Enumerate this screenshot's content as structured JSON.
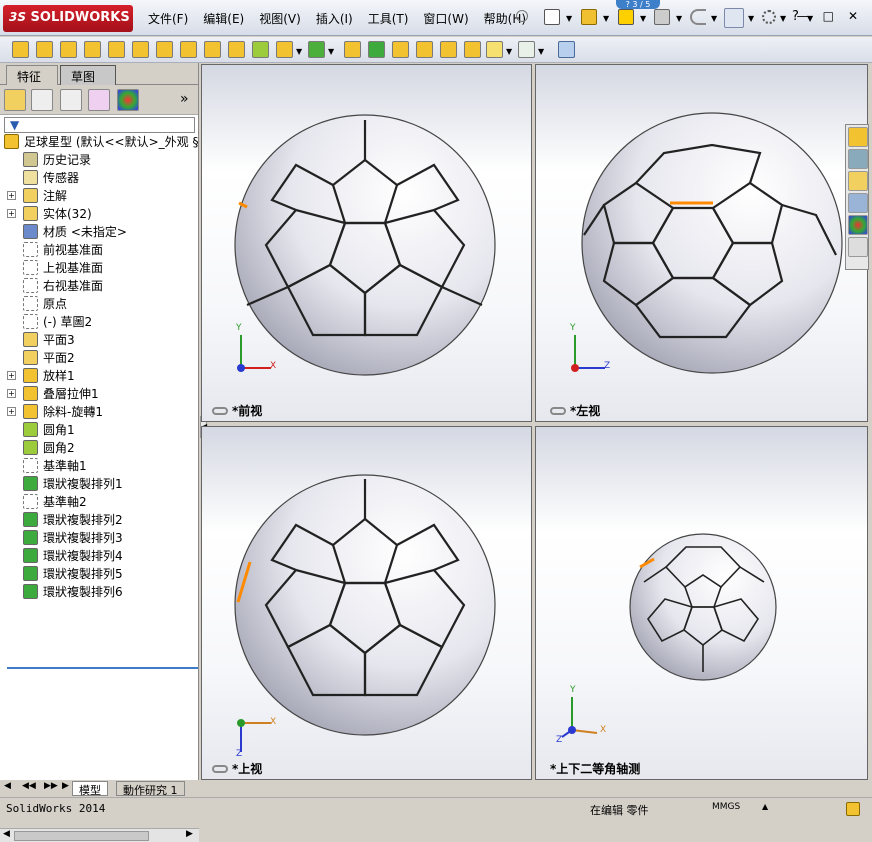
{
  "app": {
    "logo_ds": "3S",
    "logo_text": "SOLIDWORKS",
    "notify_text": "? 3 / 5"
  },
  "menu": [
    "文件(F)",
    "编辑(E)",
    "视图(V)",
    "插入(I)",
    "工具(T)",
    "窗口(W)",
    "帮助(H)"
  ],
  "window_controls": [
    "—",
    "□",
    "✕"
  ],
  "panel_tabs": {
    "features": "特征",
    "sketch": "草图"
  },
  "tree": {
    "root": "足球星型  (默认<<默认>_外观 §",
    "items": [
      {
        "label": "历史记录",
        "icon": "history-icon",
        "expand": false
      },
      {
        "label": "传感器",
        "icon": "sensor-icon",
        "expand": false
      },
      {
        "label": "注解",
        "icon": "annotation-icon",
        "expand": true
      },
      {
        "label": "实体(32)",
        "icon": "solid-bodies-icon",
        "expand": true
      },
      {
        "label": "材质 <未指定>",
        "icon": "material-icon",
        "expand": false
      },
      {
        "label": "前视基准面",
        "icon": "plane-icon",
        "expand": false
      },
      {
        "label": "上视基准面",
        "icon": "plane-icon",
        "expand": false
      },
      {
        "label": "右视基准面",
        "icon": "plane-icon",
        "expand": false
      },
      {
        "label": "原点",
        "icon": "origin-icon",
        "expand": false
      },
      {
        "label": "(-) 草圖2",
        "icon": "sketch-icon",
        "expand": false
      },
      {
        "label": "平面3",
        "icon": "plane-feature-icon",
        "expand": false
      },
      {
        "label": "平面2",
        "icon": "plane-feature-icon",
        "expand": false
      },
      {
        "label": "放样1",
        "icon": "loft-icon",
        "expand": true
      },
      {
        "label": "叠層拉伸1",
        "icon": "extrude-icon",
        "expand": true
      },
      {
        "label": "除料-旋轉1",
        "icon": "revolve-cut-icon",
        "expand": true
      },
      {
        "label": "圆角1",
        "icon": "fillet-icon",
        "expand": false
      },
      {
        "label": "圆角2",
        "icon": "fillet-icon",
        "expand": false
      },
      {
        "label": "基準軸1",
        "icon": "axis-icon",
        "expand": false
      },
      {
        "label": "環狀複製排列1",
        "icon": "circular-pattern-icon",
        "expand": false
      },
      {
        "label": "基準軸2",
        "icon": "axis-icon",
        "expand": false
      },
      {
        "label": "環狀複製排列2",
        "icon": "circular-pattern-icon",
        "expand": false
      },
      {
        "label": "環狀複製排列3",
        "icon": "circular-pattern-icon",
        "expand": false
      },
      {
        "label": "環狀複製排列4",
        "icon": "circular-pattern-icon",
        "expand": false
      },
      {
        "label": "環狀複製排列5",
        "icon": "circular-pattern-icon",
        "expand": false
      },
      {
        "label": "環狀複製排列6",
        "icon": "circular-pattern-icon",
        "expand": false
      }
    ]
  },
  "viewports": {
    "front": {
      "label": "*前视",
      "axis_a": "Y",
      "axis_b": "X"
    },
    "left": {
      "label": "*左视",
      "axis_a": "Y",
      "axis_b": "Z"
    },
    "top": {
      "label": "*上视",
      "axis_a": "X",
      "axis_b": "Z"
    },
    "iso": {
      "label": "*上下二等角轴测",
      "axis_y": "Y",
      "axis_x": "X",
      "axis_z": "Z"
    }
  },
  "bottom_tabs": [
    "模型",
    "動作研究 1"
  ],
  "status": {
    "app": "SolidWorks 2014",
    "mode": "在编辑 零件",
    "units": "MMGS",
    "units_arrow": "▲"
  },
  "colors": {
    "accent": "#3e7cc8",
    "ball": "#e8e8f0",
    "seam": "#2a2a2a",
    "highlight": "#ff8a00",
    "logo": "#c8141e"
  }
}
